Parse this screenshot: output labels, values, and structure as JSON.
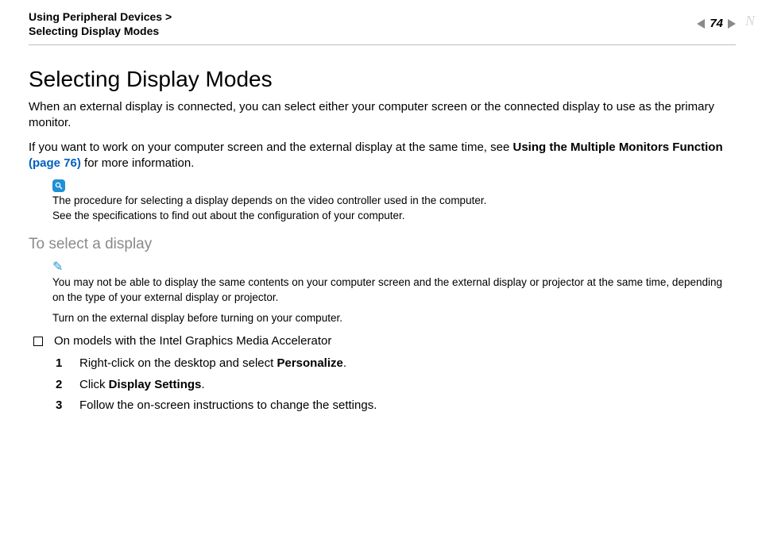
{
  "header": {
    "breadcrumb_line1": "Using Peripheral Devices >",
    "breadcrumb_line2": "Selecting Display Modes",
    "page_number": "74"
  },
  "title": "Selecting Display Modes",
  "intro_para": "When an external display is connected, you can select either your computer screen or the connected display to use as the primary monitor.",
  "para2_pre": "If you want to work on your computer screen and the external display at the same time, see ",
  "para2_bold": "Using the Multiple Monitors Function ",
  "para2_link": "(page 76)",
  "para2_post": " for more information.",
  "note1_line1": "The procedure for selecting a display depends on the video controller used in the computer.",
  "note1_line2": "See the specifications to find out about the configuration of your computer.",
  "subhead": "To select a display",
  "tip_text": "You may not be able to display the same contents on your computer screen and the external display or projector at the same time, depending on the type of your external display or projector.",
  "tip_extra": "Turn on the external display before turning on your computer.",
  "bullet_text": "On models with the Intel Graphics Media Accelerator",
  "steps": [
    {
      "num": "1",
      "pre": "Right-click on the desktop and select ",
      "bold": "Personalize",
      "post": "."
    },
    {
      "num": "2",
      "pre": "Click ",
      "bold": "Display Settings",
      "post": "."
    },
    {
      "num": "3",
      "pre": "Follow the on-screen instructions to change the settings.",
      "bold": "",
      "post": ""
    }
  ]
}
